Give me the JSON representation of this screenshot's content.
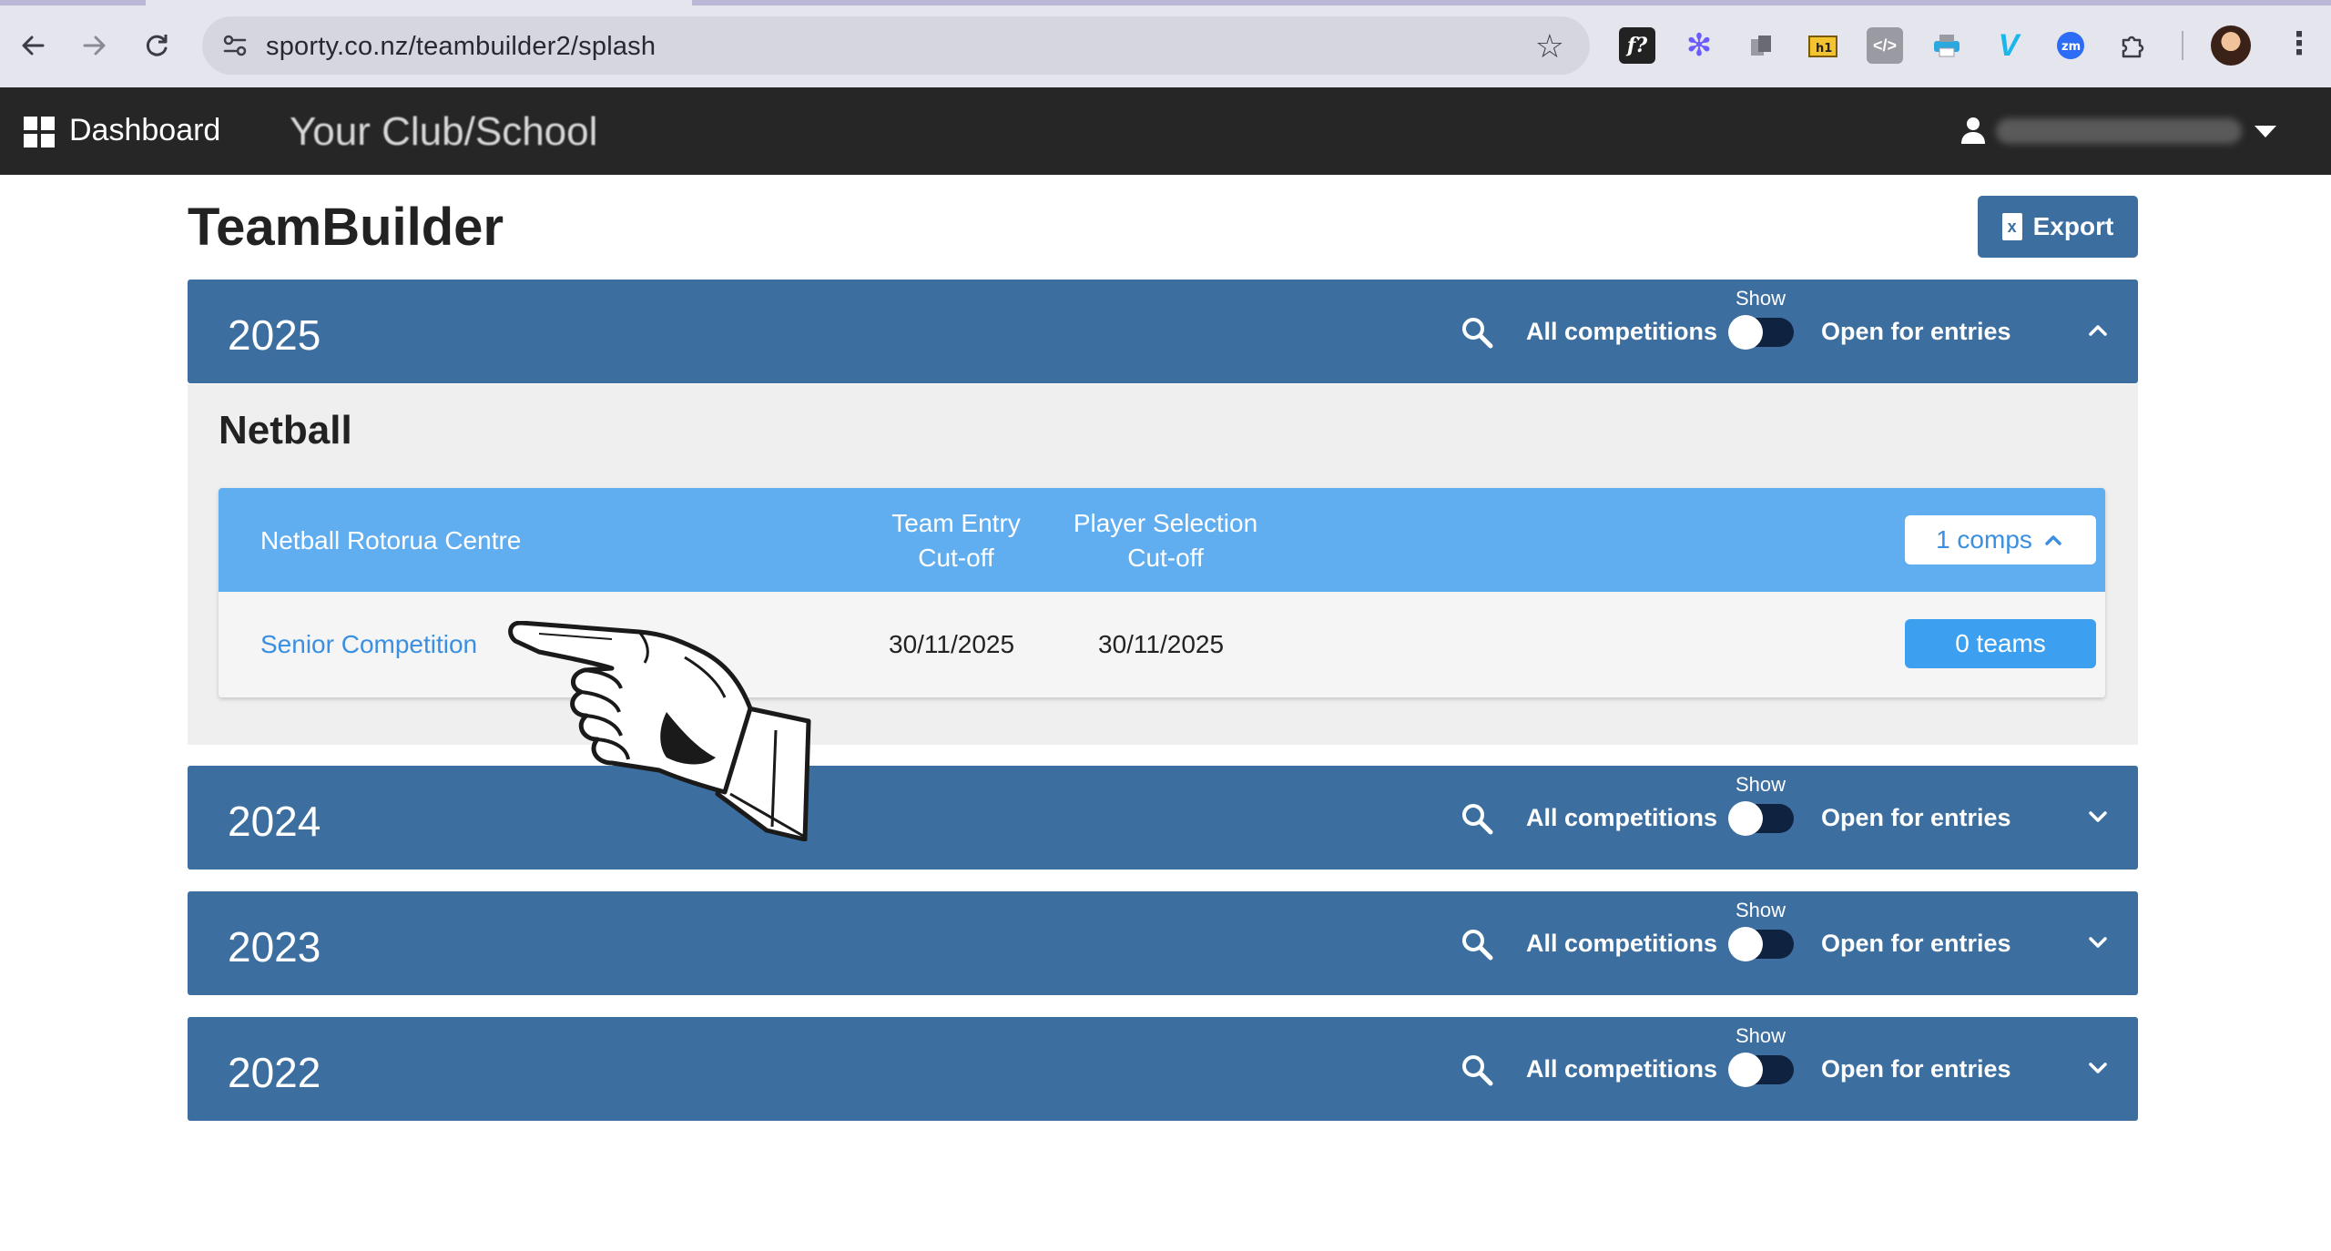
{
  "browser": {
    "url": "sporty.co.nz/teambuilder2/splash",
    "extensions": [
      "fontface-icon",
      "color-picker-icon",
      "copy-icon",
      "folder-icon",
      "code-icon",
      "printer-icon",
      "vimeo-icon",
      "zoom-icon",
      "puzzle-icon"
    ]
  },
  "header": {
    "dashboard_label": "Dashboard",
    "club_name": "Your Club/School"
  },
  "page": {
    "title": "TeamBuilder",
    "export_label": "Export"
  },
  "filters": {
    "all_competitions": "All competitions",
    "show_label": "Show",
    "open_for_entries": "Open for entries"
  },
  "years": [
    {
      "year": "2025",
      "expanded": true
    },
    {
      "year": "2024",
      "expanded": false
    },
    {
      "year": "2023",
      "expanded": false
    },
    {
      "year": "2022",
      "expanded": false
    }
  ],
  "sport": {
    "name": "Netball",
    "organisation": "Netball Rotorua Centre",
    "columns": {
      "team_entry_1": "Team Entry",
      "team_entry_2": "Cut-off",
      "player_selection_1": "Player Selection",
      "player_selection_2": "Cut-off"
    },
    "comps_label": "1 comps",
    "competitions": [
      {
        "name": "Senior Competition",
        "team_entry_cutoff": "30/11/2025",
        "player_selection_cutoff": "30/11/2025",
        "teams_label": "0 teams"
      }
    ]
  },
  "colors": {
    "header_bg": "#262626",
    "year_bar": "#3c6e9f",
    "org_head": "#60aef0",
    "link": "#3a8fe0"
  }
}
